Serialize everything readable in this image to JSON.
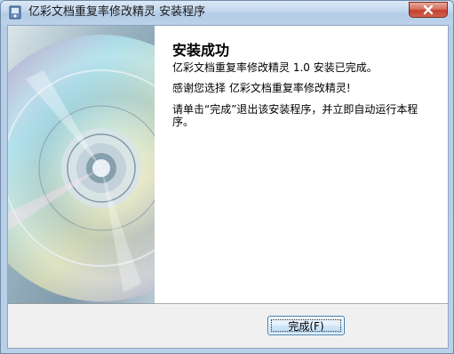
{
  "window": {
    "title": "亿彩文档重复率修改精灵 安装程序"
  },
  "content": {
    "heading": "安装成功",
    "line1": "亿彩文档重复率修改精灵 1.0 安装已完成。",
    "line2": "感谢您选择 亿彩文档重复率修改精灵!",
    "line3": "请单击“完成”退出该安装程序，并立即自动运行本程序。"
  },
  "buttons": {
    "finish_label": "完成(F)"
  },
  "icons": {
    "app": "installer-app-icon",
    "close": "close-icon",
    "banner": "cd-disc-image"
  },
  "colors": {
    "close_button": "#c2402c",
    "window_frame": "#b9d0e9",
    "finish_button_border": "#3c7fb1"
  }
}
